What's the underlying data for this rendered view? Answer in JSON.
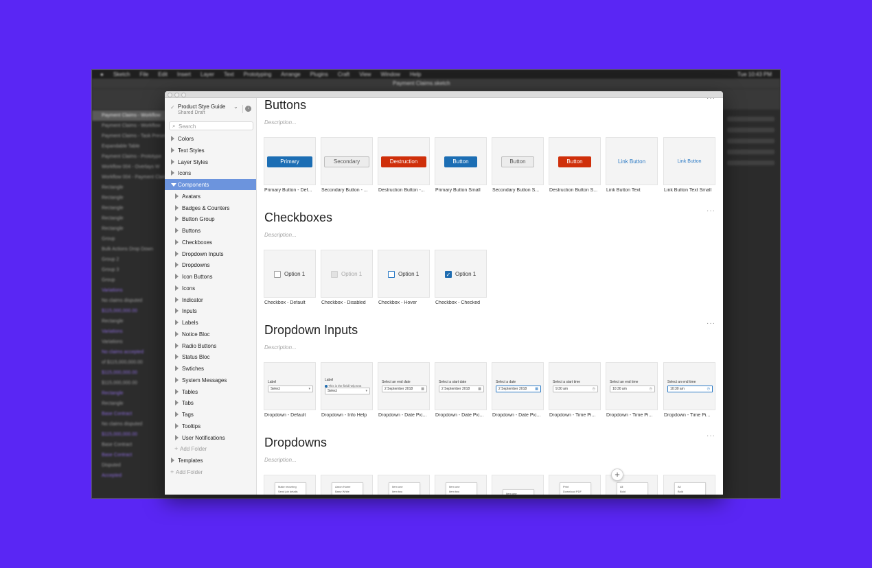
{
  "background_color": "#5a26f4",
  "desktop": {
    "menubar": [
      "Sketch",
      "File",
      "Edit",
      "Insert",
      "Layer",
      "Text",
      "Prototyping",
      "Arrange",
      "Plugins",
      "Craft",
      "View",
      "Window",
      "Help"
    ],
    "menubar_right": "Tue 10:43 PM",
    "document_title": "Payment Claims.sketch",
    "layers": [
      "Payment Claims - Workflow",
      "Payment Claims - Workflow",
      "Payment Claims - Task Present",
      "Expandable Table",
      "Payment Claims - Prototype",
      "Workflow 004 - Overlays W",
      "Workflow 004 - Payment Claim",
      "Rectangle",
      "Rectangle",
      "Rectangle",
      "Rectangle",
      "Rectangle",
      "Group",
      "Bulk Actions Drop Down",
      "Group 2",
      "Group 3",
      "Group",
      "Variations",
      "No claims disputed",
      "$115,000,000.00",
      "Rectangle",
      "Variations",
      "Variations",
      "No claims accepted",
      "of $115,000,000.00",
      "$115,000,000.00",
      "$115,000,000.00",
      "Rectangle",
      "Rectangle",
      "Base Contract",
      "No claims disputed",
      "$115,000,000.00",
      "Base Contract",
      "Base Contract",
      "Disputed",
      "Accepted"
    ]
  },
  "library": {
    "title": "Product Stye Guide",
    "subtitle": "Shared Draft",
    "search_placeholder": "Search"
  },
  "tree": {
    "top": [
      "Colors",
      "Text Styles",
      "Layer Styles",
      "Icons"
    ],
    "selected": "Components",
    "children": [
      "Avatars",
      "Badges & Counters",
      "Button Group",
      "Buttons",
      "Checkboxes",
      "Dropdown Inputs",
      "Dropdowns",
      "Icon Buttons",
      "Icons",
      "Indicator",
      "Inputs",
      "Labels",
      "Notice Bloc",
      "Radio Buttons",
      "Status Bloc",
      "Swtiches",
      "System Messages",
      "Tables",
      "Tabs",
      "Tags",
      "Tooltips",
      "User Notifications"
    ],
    "add_folder_child": "Add Folder",
    "templates": "Templates",
    "add_folder_root": "Add Folder"
  },
  "sections": {
    "more": "···",
    "buttons": {
      "title": "Buttons",
      "description": "Description...",
      "cards": [
        {
          "button": "Primary",
          "caption": "Primary Button - Def..."
        },
        {
          "button": "Secondary",
          "caption": "Secondary Button - ..."
        },
        {
          "button": "Destruction",
          "caption": "Destruction Button -..."
        },
        {
          "button": "Button",
          "caption": "Primary Button Small"
        },
        {
          "button": "Button",
          "caption": "Secondary Button S..."
        },
        {
          "button": "Button",
          "caption": "Destruction Button S..."
        },
        {
          "button": "Link Button",
          "caption": "Link Button Text"
        },
        {
          "button": "Link Button",
          "caption": "Link Button Text Small"
        }
      ]
    },
    "checkboxes": {
      "title": "Checkboxes",
      "description": "Description...",
      "cards": [
        {
          "label": "Option 1",
          "caption": "Checkbox - Default"
        },
        {
          "label": "Option 1",
          "caption": "Checkbox - Disabled"
        },
        {
          "label": "Option 1",
          "caption": "Checkbox - Hover"
        },
        {
          "label": "Option 1",
          "caption": "Checkbox - Checked"
        }
      ]
    },
    "dropdown_inputs": {
      "title": "Dropdown Inputs",
      "description": "Description...",
      "cards": [
        {
          "label": "Label",
          "value": "Select",
          "help": "",
          "caption": "Dropdown - Default"
        },
        {
          "label": "Label",
          "value": "Select",
          "help": "This is the field help text",
          "caption": "Dropdown - Info Help"
        },
        {
          "label": "Select an end date",
          "value": "2 September 2018",
          "help": "",
          "caption": "Dropdown - Date Pic..."
        },
        {
          "label": "Select a start date",
          "value": "2 September 2018",
          "help": "",
          "caption": "Dropdown - Date Pic..."
        },
        {
          "label": "Select a date",
          "value": "2 September 2018",
          "help": "",
          "caption": "Dropdown - Date Pic..."
        },
        {
          "label": "Select a start time",
          "value": "9:30 am",
          "help": "",
          "caption": "Dropdown - Time Pi..."
        },
        {
          "label": "Select an end time",
          "value": "10:30 am",
          "help": "",
          "caption": "Dropdown - Time Pi..."
        },
        {
          "label": "Select an end time",
          "value": "10:30 am",
          "help": "",
          "caption": "Dropdown - Time Pi..."
        }
      ]
    },
    "dropdowns": {
      "title": "Dropdowns",
      "description": "Description...",
      "previews": [
        [
          "Make recurring",
          "Send job details"
        ],
        [
          "Aaron Hume",
          "Barry White",
          "Lisa Jones"
        ],
        [
          "Item one",
          "Item two"
        ],
        [
          "Item one",
          "Item two"
        ],
        [
          "Item one"
        ],
        [
          "Print",
          "Download PDF"
        ],
        [
          "All",
          "Bold"
        ],
        [
          "All",
          "Bold"
        ]
      ]
    }
  },
  "colors": {
    "primary": "#1c6eb4",
    "destruction": "#cf2f0a",
    "link": "#2a79c4",
    "selection": "#6c94dd"
  }
}
